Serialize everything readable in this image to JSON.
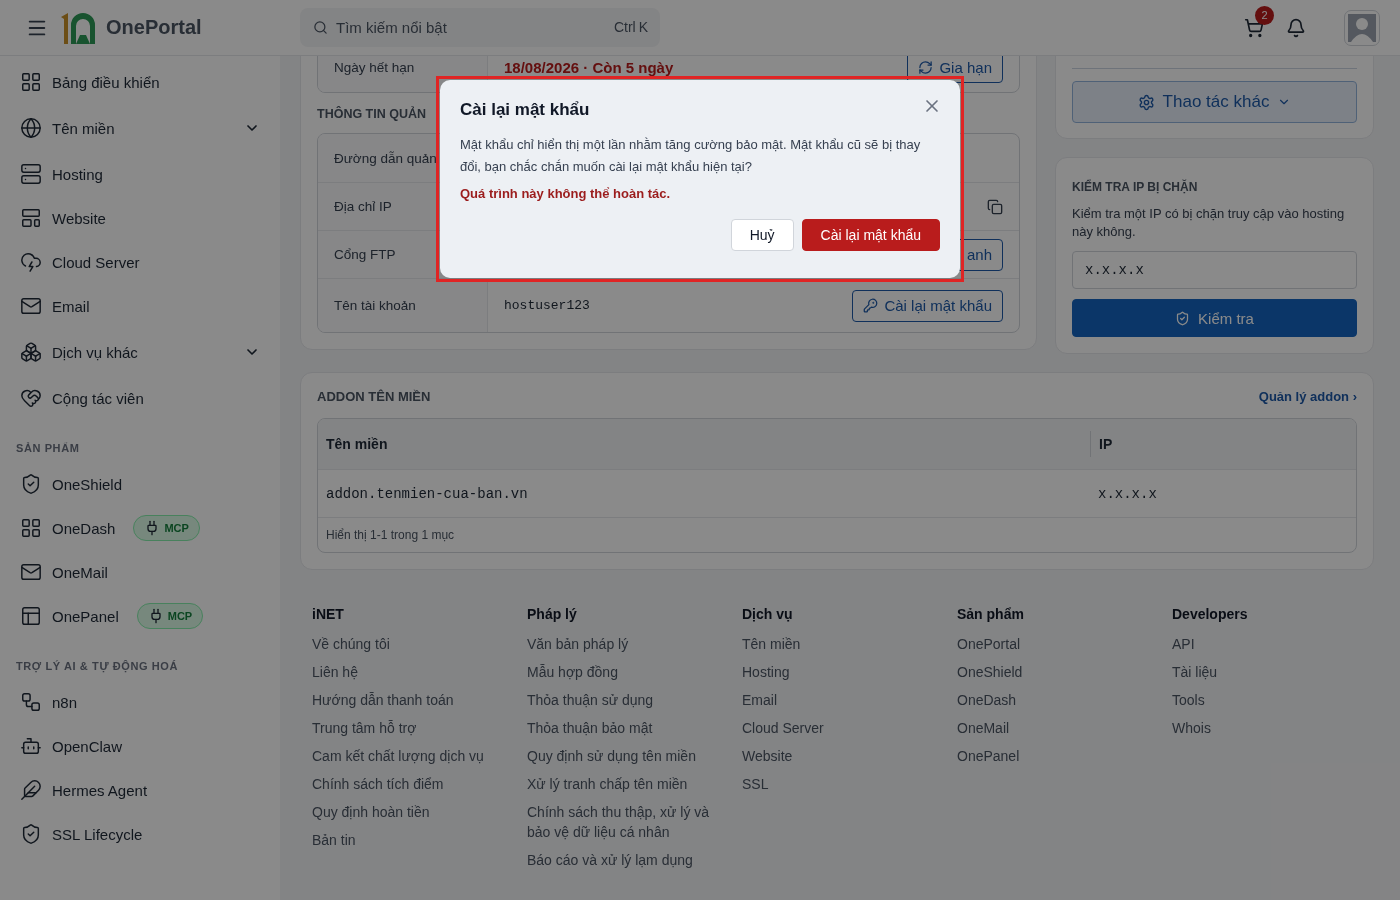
{
  "header": {
    "brand": "OnePortal",
    "search": {
      "placeholder": "Tìm kiếm nổi bật",
      "shortcut": [
        "Ctrl",
        "K"
      ]
    },
    "cart_count": "2"
  },
  "sidebar": {
    "sections": [
      {
        "items": [
          {
            "label": "Bảng điều khiển",
            "kind": "link"
          },
          {
            "label": "Tên miền",
            "kind": "group"
          },
          {
            "label": "Hosting",
            "kind": "link"
          },
          {
            "label": "Website",
            "kind": "link"
          },
          {
            "label": "Cloud Server",
            "kind": "link"
          },
          {
            "label": "Email",
            "kind": "link"
          },
          {
            "label": "Dịch vụ khác",
            "kind": "group"
          },
          {
            "label": "Cộng tác viên",
            "kind": "link"
          }
        ]
      },
      {
        "title": "SẢN PHẨM",
        "items": [
          {
            "label": "OneShield",
            "kind": "link"
          },
          {
            "label": "OneDash",
            "kind": "link",
            "badge": "MCP"
          },
          {
            "label": "OneMail",
            "kind": "link"
          },
          {
            "label": "OnePanel",
            "kind": "link",
            "badge": "MCP"
          }
        ]
      },
      {
        "title": "TRỢ LÝ AI & TỰ ĐỘNG HOÁ",
        "items": [
          {
            "label": "n8n",
            "kind": "link"
          },
          {
            "label": "OpenClaw",
            "kind": "link"
          },
          {
            "label": "Hermes Agent",
            "kind": "link"
          },
          {
            "label": "SSL Lifecycle",
            "kind": "link"
          }
        ]
      }
    ]
  },
  "service_card": {
    "rows": [
      {
        "label": "Ngày hết hạn",
        "value": "18/08/2026 · Còn 5 ngày",
        "alert": true,
        "action": {
          "kind": "renew",
          "label": "Gia hạn"
        }
      }
    ],
    "section_title": "THÔNG TIN QUẢN",
    "info_rows": [
      {
        "label": "Đường dẫn quản"
      },
      {
        "label": "Địa chỉ IP",
        "action": {
          "kind": "copy"
        }
      },
      {
        "label": "Cổng FTP",
        "action": {
          "kind": "plain",
          "label": "anh"
        }
      },
      {
        "label": "Tên tài khoản",
        "value": "hostuser123",
        "alert": false,
        "action": {
          "kind": "reset",
          "label": "Cài lại mật khẩu"
        }
      }
    ]
  },
  "actions_card": {
    "button": "Thao tác khác"
  },
  "ip_check": {
    "title": "KIỂM TRA IP BỊ CHẶN",
    "description": "Kiểm tra một IP có bị chặn truy cập vào hosting này không.",
    "input": {
      "value": "x.x.x.x"
    },
    "button": "Kiểm tra"
  },
  "addon": {
    "title": "ADDON TÊN MIỀN",
    "link": "Quản lý addon ›",
    "columns": [
      "Tên miền",
      "IP"
    ],
    "rows": [
      [
        "addon.tenmien-cua-ban.vn",
        "x.x.x.x"
      ]
    ],
    "summary": "Hiển thị 1-1 trong 1 mục"
  },
  "footer": [
    {
      "title": "iNET",
      "links": [
        "Về chúng tôi",
        "Liên hệ",
        "Hướng dẫn thanh toán",
        "Trung tâm hỗ trợ",
        "Cam kết chất lượng dịch vụ",
        "Chính sách tích điểm",
        "Quy định hoàn tiền",
        "Bản tin"
      ]
    },
    {
      "title": "Pháp lý",
      "links": [
        "Văn bản pháp lý",
        "Mẫu hợp đồng",
        "Thỏa thuận sử dụng",
        "Thỏa thuận bảo mật",
        "Quy định sử dụng tên miền",
        "Xử lý tranh chấp tên miền",
        "Chính sách thu thập, xử lý và bảo vệ dữ liệu cá nhân",
        "Báo cáo và xử lý lạm dụng"
      ]
    },
    {
      "title": "Dịch vụ",
      "links": [
        "Tên miền",
        "Hosting",
        "Email",
        "Cloud Server",
        "Website",
        "SSL"
      ]
    },
    {
      "title": "Sản phẩm",
      "links": [
        "OnePortal",
        "OneShield",
        "OneDash",
        "OneMail",
        "OnePanel"
      ]
    },
    {
      "title": "Developers",
      "links": [
        "API",
        "Tài liệu",
        "Tools",
        "Whois"
      ]
    }
  ],
  "modal": {
    "title": "Cài lại mật khẩu",
    "message": "Mật khẩu chỉ hiển thị một lần nhằm tăng cường bảo mật. Mật khẩu cũ sẽ bị thay đổi, bạn chắc chắn muốn cài lại mật khẩu hiện tại?",
    "warning": "Quá trình này không thể hoàn tác.",
    "buttons": [
      {
        "label": "Huỷ",
        "kind": "secondary"
      },
      {
        "label": "Cài lại mật khẩu",
        "kind": "primary"
      }
    ]
  }
}
